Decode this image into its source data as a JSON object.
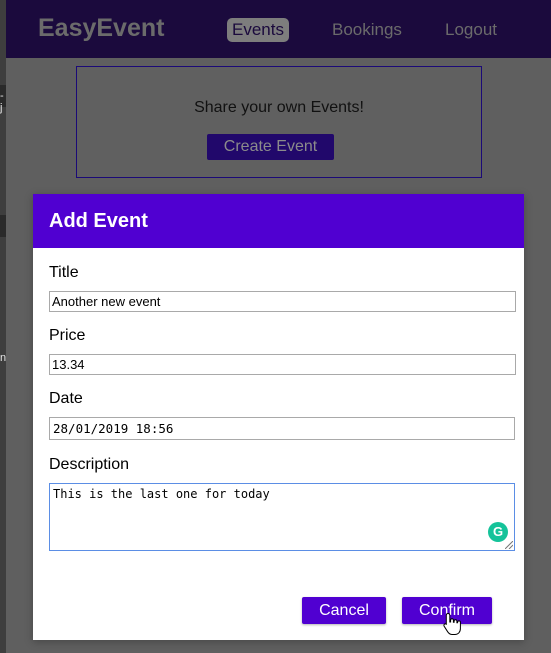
{
  "navbar": {
    "brand": "EasyEvent",
    "items": [
      {
        "label": "Events",
        "active": true
      },
      {
        "label": "Bookings",
        "active": false
      },
      {
        "label": "Logout",
        "active": false
      }
    ]
  },
  "background_page": {
    "share_text": "Share your own Events!",
    "create_button": "Create Event",
    "left_chars": [
      "-j",
      "n"
    ]
  },
  "modal": {
    "title": "Add Event",
    "fields": {
      "title_label": "Title",
      "title_value": "Another new event",
      "price_label": "Price",
      "price_value": "13.34",
      "date_label": "Date",
      "date_value": "28/01/2019 18:56",
      "description_label": "Description",
      "description_value": "This is the last one for today"
    },
    "cancel_label": "Cancel",
    "confirm_label": "Confirm"
  },
  "colors": {
    "accent": "#5000d1",
    "navbar": "#1b0a3d",
    "grammarly": "#15c39a"
  }
}
